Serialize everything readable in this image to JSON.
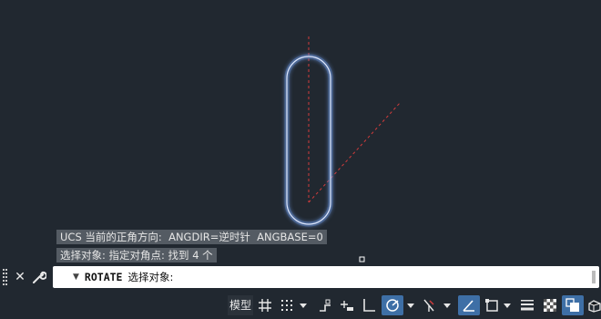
{
  "history": {
    "line1": "UCS 当前的正角方向:  ANGDIR=逆时针  ANGBASE=0",
    "line2": "选择对象: 指定对角点: 找到 4 个"
  },
  "command": {
    "keyword": "ROTATE",
    "prompt": "选择对象:"
  },
  "status_bar": {
    "model_tab": "模型"
  },
  "colors": {
    "background": "#212830",
    "slot_outline": "#3f77d6",
    "axis_line": "#d23c3c",
    "active_toggle": "#3e6fa6"
  },
  "icons": [
    "close-icon",
    "wrench-icon",
    "grid-icon",
    "snap-icon",
    "ortho-icon",
    "polar-icon",
    "osnap-icon",
    "dynamic-ucs-icon",
    "selection-cycling-icon",
    "lineweight-icon",
    "transparency-icon",
    "quick-properties-icon",
    "annotation-icon"
  ]
}
